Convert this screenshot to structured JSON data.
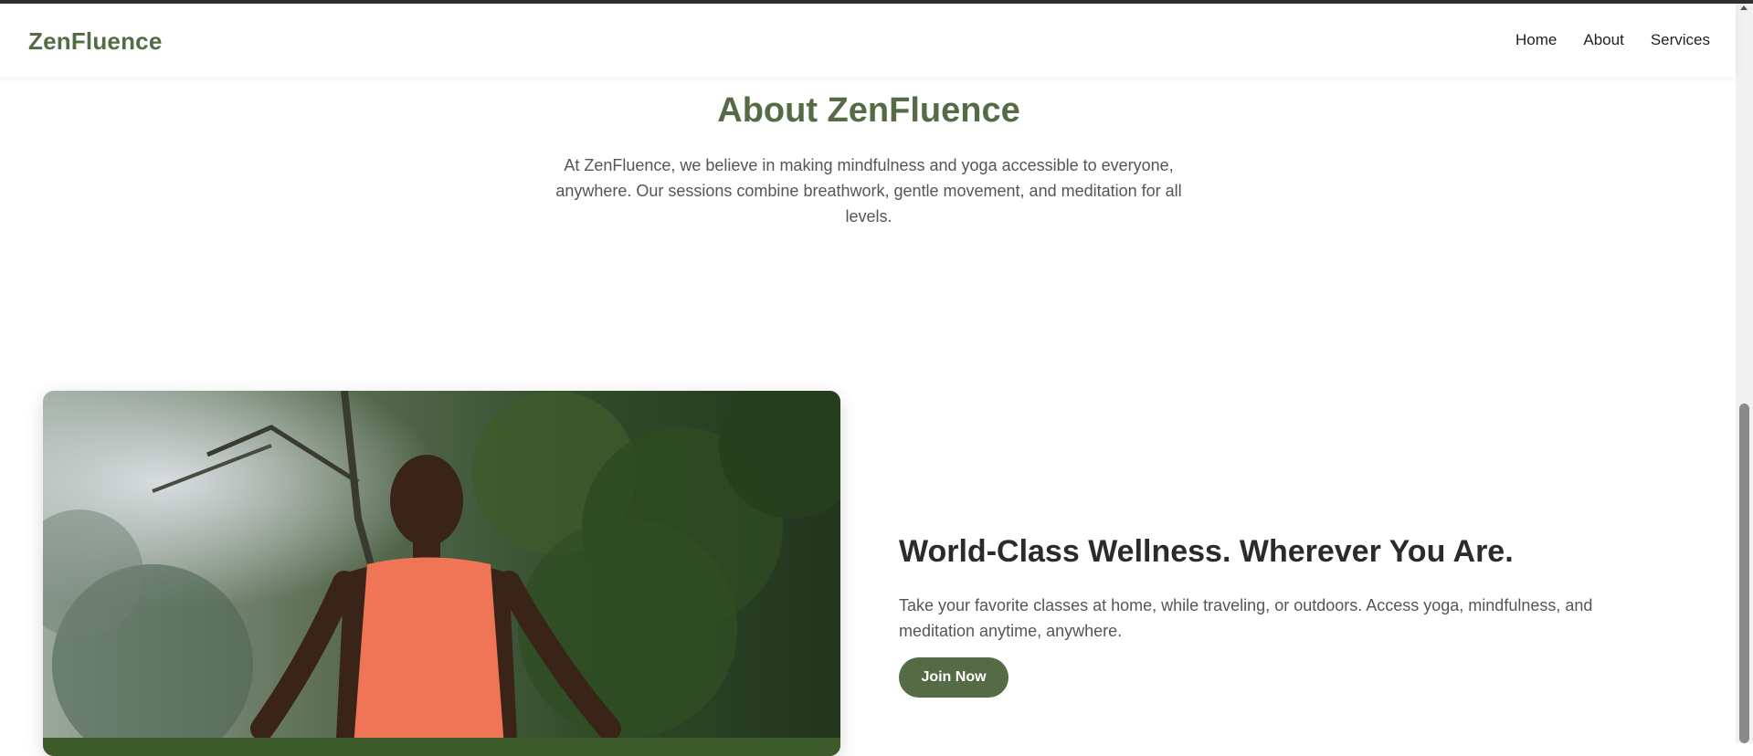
{
  "nav": {
    "brand": "ZenFluence",
    "links": [
      "Home",
      "About",
      "Services"
    ]
  },
  "about": {
    "title": "About ZenFluence",
    "text": "At ZenFluence, we believe in making mindfulness and yoga accessible to everyone, anywhere. Our sessions combine breathwork, gentle movement, and meditation for all levels."
  },
  "feature": {
    "title": "World-Class Wellness. Wherever You Are.",
    "text": "Take your favorite classes at home, while traveling, or outdoors. Access yoga, mindfulness, and meditation anytime, anywhere.",
    "button_label": "Join Now",
    "image_alt": "woman-meditating-outdoors"
  },
  "colors": {
    "brand": "#556b45",
    "heading": "#2b2b2b",
    "body_text": "#555555"
  }
}
